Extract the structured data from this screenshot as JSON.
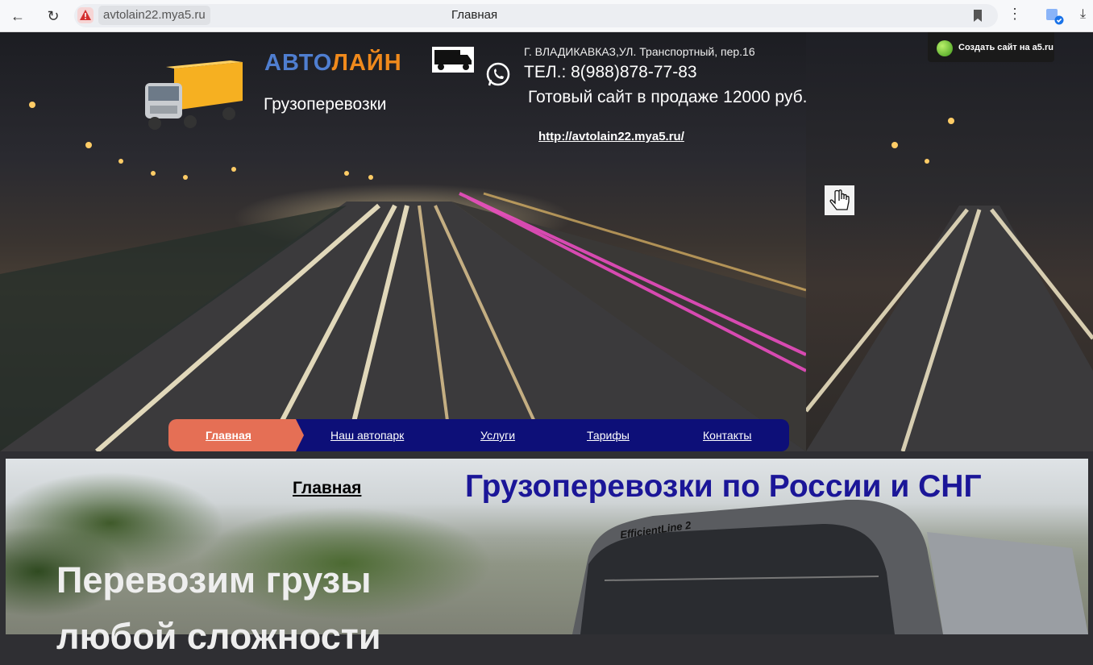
{
  "browser": {
    "url": "avtolain22.mya5.ru",
    "tab_title": "Главная"
  },
  "header": {
    "brand_part1": "АВТО",
    "brand_part2": "ЛАЙН",
    "subtitle": "Грузоперевозки",
    "address": "Г. ВЛАДИКАВКАЗ,УЛ. Транспортный, пер.16",
    "phone": "ТЕЛ.: 8(988)878-77-83",
    "sale": "Готовый сайт в продаже 12000 руб.",
    "link": "http://avtolain22.mya5.ru/",
    "a5_badge": "Создать сайт на a5.ru"
  },
  "nav": {
    "items": [
      "Главная",
      "Наш автопарк",
      "Услуги",
      "Тарифы",
      "Контакты"
    ],
    "active": "Главная"
  },
  "content": {
    "breadcrumb": "Главная",
    "heading": "Грузоперевозки по России и СНГ",
    "hero_line1": "Перевозим грузы",
    "hero_line2": "любой сложности",
    "truck_badge": "EfficientLine 2"
  },
  "colors": {
    "brand_blue": "#4f7ed0",
    "brand_orange": "#f08a1c",
    "nav_bg": "#0d0f78",
    "nav_active": "#e56f55",
    "heading": "#1b1698"
  }
}
